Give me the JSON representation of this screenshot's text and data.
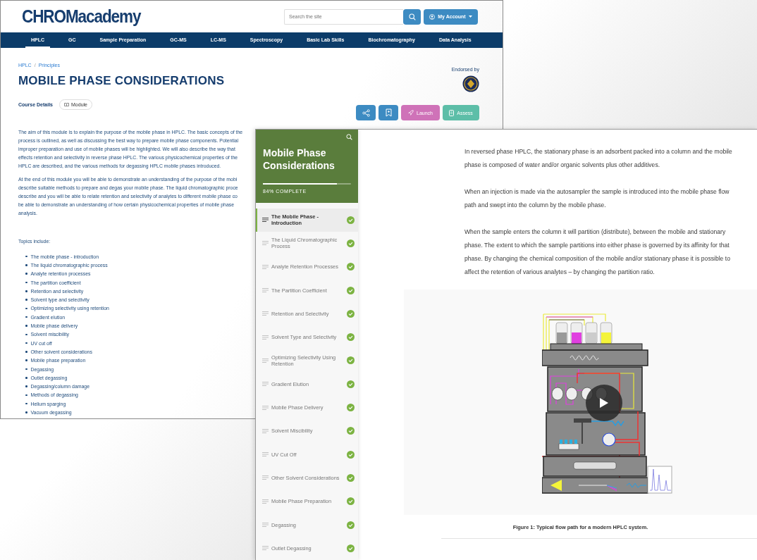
{
  "back_window": {
    "logo": "CHROMacademy",
    "search": {
      "placeholder": "Search the site"
    },
    "account_button": "My Account",
    "nav": [
      {
        "label": "HPLC",
        "selected": true
      },
      {
        "label": "GC",
        "selected": false
      },
      {
        "label": "Sample Preparation",
        "selected": false
      },
      {
        "label": "GC-MS",
        "selected": false
      },
      {
        "label": "LC-MS",
        "selected": false
      },
      {
        "label": "Spectroscopy",
        "selected": false
      },
      {
        "label": "Basic Lab Skills",
        "selected": false
      },
      {
        "label": "Biochromatography",
        "selected": false
      },
      {
        "label": "Data Analysis",
        "selected": false
      }
    ],
    "breadcrumb": [
      "HPLC",
      "Principles"
    ],
    "breadcrumb_separator": "/",
    "title": "MOBILE PHASE CONSIDERATIONS",
    "endorsed_label": "Endorsed by",
    "course_details": "Course Details",
    "module_chip": "Module",
    "actions": [
      {
        "kind": "share"
      },
      {
        "kind": "bookmark"
      },
      {
        "kind": "launch",
        "label": "Launch"
      },
      {
        "kind": "assess",
        "label": "Assess"
      }
    ],
    "intro_paragraphs": [
      [
        "The aim of this module is to explain the purpose of the mobile phase in HPLC. The basic concepts of the",
        "process is outlined, as well as discussing the best way to prepare mobile phase components. Potential",
        "improper preparation and use of mobile phases will be highlighted. We will also describe the way that",
        "effects retention and selectivity in reverse phase HPLC. The various physicochemical properties of the",
        "HPLC are described, and the various methods for degassing HPLC mobile phases introduced."
      ],
      [
        "At the end of this module you will be able to demonstrate an understanding of the purpose of the mobi",
        "describe suitable methods to prepare and degas your mobile phase. The liquid chromatographic proce",
        "describe and you will be able to relate retention and selectivity of analytes to different mobile phase co",
        "be able to demonstrate an understanding of how certain physicochemical properties of mobile phase",
        "analysis."
      ]
    ],
    "topics_heading": "Topics include:",
    "topics": [
      "The mobile phase - introduction",
      "The liquid chromatographic process",
      "Analyte retention processes",
      "The partition coefficient",
      "Retention and selectivity",
      "Solvent type and selectivity",
      "Optimizing selectivity using retention",
      "Gradient elution",
      "Mobile phase delivery",
      "Solvent miscibility",
      "UV cut off",
      "Other solvent considerations",
      "Mobile phase preparation",
      "Degassing",
      "Outlet degassing",
      "Degassing/column damage",
      "Methods of degassing",
      "Helium sparging",
      "Vacuum degassing"
    ]
  },
  "front_window": {
    "sidebar": {
      "title": "Mobile Phase Considerations",
      "progress": {
        "level": 0.84,
        "label": "84% COMPLETE"
      },
      "lessons": [
        {
          "title": "The Mobile Phase - Introduction",
          "selected": true,
          "completed": true
        },
        {
          "title": "The Liquid Chromatographic Process",
          "selected": false,
          "completed": true
        },
        {
          "title": "Analyte Retention Processes",
          "selected": false,
          "completed": true
        },
        {
          "title": "The Partition Coefficient",
          "selected": false,
          "completed": true
        },
        {
          "title": "Retention and Selectivity",
          "selected": false,
          "completed": true
        },
        {
          "title": "Solvent Type and Selectivity",
          "selected": false,
          "completed": true
        },
        {
          "title": "Optimizing Selectivity Using Retention",
          "selected": false,
          "completed": true
        },
        {
          "title": "Gradient Elution",
          "selected": false,
          "completed": true
        },
        {
          "title": "Mobile Phase Delivery",
          "selected": false,
          "completed": true
        },
        {
          "title": "Solvent Miscibility",
          "selected": false,
          "completed": true
        },
        {
          "title": "UV Cut Off",
          "selected": false,
          "completed": true
        },
        {
          "title": "Other Solvent Considerations",
          "selected": false,
          "completed": true
        },
        {
          "title": "Mobile Phase Preparation",
          "selected": false,
          "completed": true
        },
        {
          "title": "Degassing",
          "selected": false,
          "completed": true
        },
        {
          "title": "Outlet Degassing",
          "selected": false,
          "completed": true
        }
      ]
    },
    "content": {
      "paragraphs": [
        "In reversed phase HPLC, the stationary phase is an adsorbent packed into a column and the mobile phase is composed of water and/or organic solvents plus other additives.",
        "When an injection is made via the autosampler the sample is introduced into the mobile phase flow path and swept into the column by the mobile phase.",
        "When the sample enters the column it will partition (distribute), between the mobile and stationary phase. The extent to which the sample partitions into either phase is governed by its affinity for that phase. By changing the chemical composition of the mobile and/or stationary phase it is possible to affect the retention of various analytes – by changing the partition ratio."
      ],
      "figure": {
        "caption": "Figure 1: Typical flow path for a modern HPLC system."
      }
    }
  }
}
